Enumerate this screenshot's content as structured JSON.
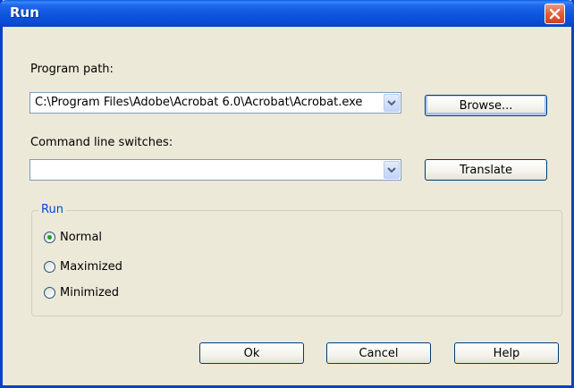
{
  "window": {
    "title": "Run"
  },
  "program_path": {
    "label": "Program path:",
    "value": "C:\\Program Files\\Adobe\\Acrobat 6.0\\Acrobat\\Acrobat.exe",
    "browse_label": "Browse..."
  },
  "command_line": {
    "label": "Command line switches:",
    "value": "",
    "translate_label": "Translate"
  },
  "run_group": {
    "legend": "Run",
    "options": [
      {
        "label": "Normal",
        "selected": true
      },
      {
        "label": "Maximized",
        "selected": false
      },
      {
        "label": "Minimized",
        "selected": false
      }
    ]
  },
  "buttons": {
    "ok": "Ok",
    "cancel": "Cancel",
    "help": "Help"
  },
  "colors": {
    "titlebar": "#0A4CD2",
    "close": "#E2613C",
    "group_legend": "#0046D5",
    "radio_dot": "#21A121"
  },
  "icons": {
    "close": "close-icon",
    "dropdown": "chevron-down-icon"
  }
}
